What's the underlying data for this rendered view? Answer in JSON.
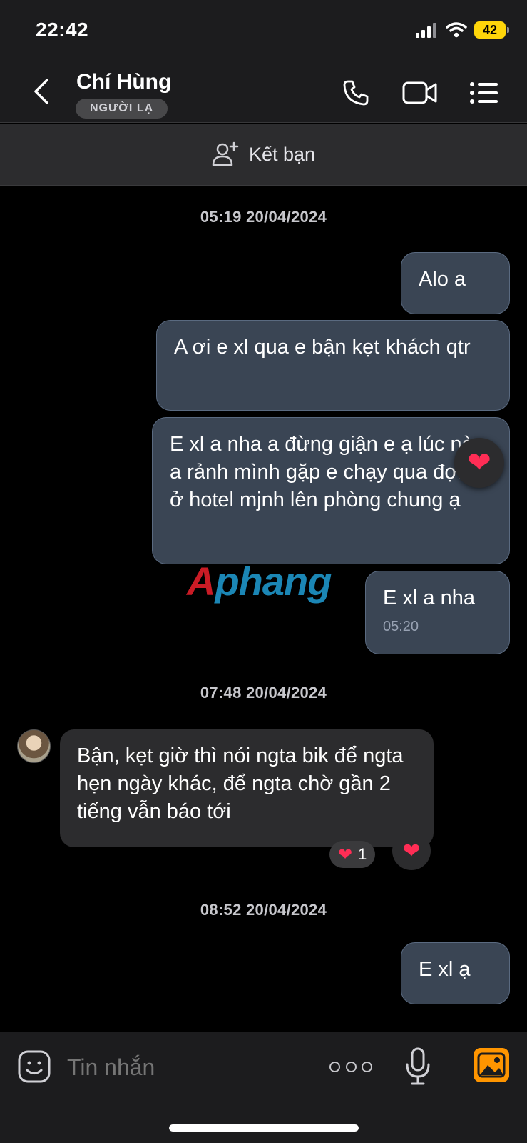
{
  "status_bar": {
    "time": "22:42",
    "battery": "42"
  },
  "header": {
    "contact_name": "Chí Hùng",
    "badge": "NGƯỜI LẠ"
  },
  "add_friend": {
    "label": "Kết bạn"
  },
  "chat": {
    "groups": [
      {
        "timestamp": "05:19 20/04/2024",
        "messages": [
          {
            "text": "Alo a"
          },
          {
            "text": "A ơi e xl qua e bận kẹt khách qtr"
          },
          {
            "text": "E xl a nha a đừng giận e ạ lúc nào a rảnh mình gặp e chạy qua đợi a ở hotel mjnh lên phòng chung ạ",
            "reaction": "❤"
          },
          {
            "text": "E xl a nha",
            "time": "05:20"
          }
        ]
      },
      {
        "timestamp": "07:48 20/04/2024",
        "messages": [
          {
            "text": "Bận, kẹt giờ thì nói ngta bik để ngta hẹn ngày khác, để ngta chờ gần 2 tiếng vẫn báo tới",
            "reaction_count": "1",
            "reaction_heart": "❤"
          }
        ]
      },
      {
        "timestamp": "08:52 20/04/2024",
        "messages": [
          {
            "text": "E xl ạ"
          }
        ]
      }
    ]
  },
  "watermark": {
    "part1": "A",
    "part2": "phang"
  },
  "input": {
    "placeholder": "Tin nhắn"
  },
  "colors": {
    "outgoing_bubble": "#3a4554",
    "incoming_bubble": "#2c2c2e",
    "reaction": "#ff2d55",
    "image_button": "#ff9500",
    "battery": "#ffd60a"
  }
}
